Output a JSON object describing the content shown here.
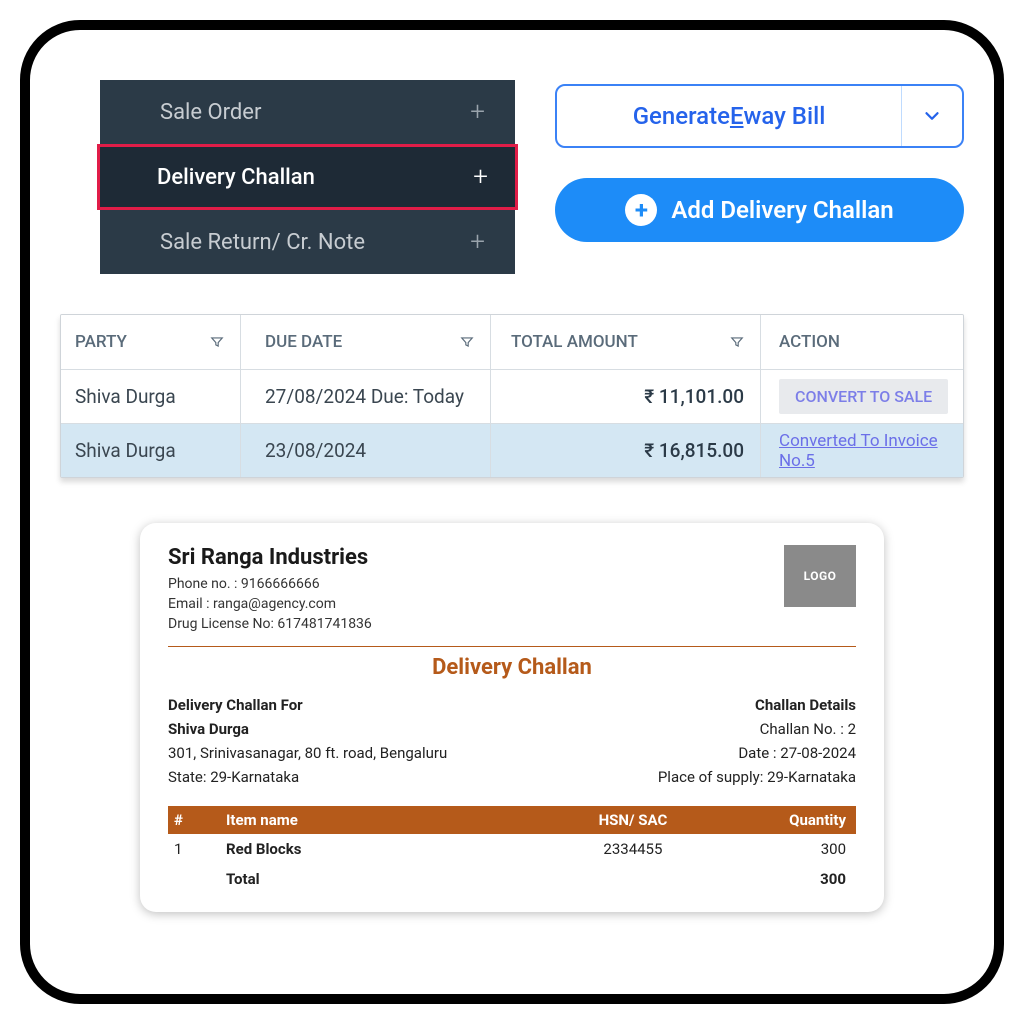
{
  "menu": {
    "items": [
      {
        "label": "Sale Order"
      },
      {
        "label": "Delivery Challan"
      },
      {
        "label": "Sale Return/ Cr. Note"
      }
    ]
  },
  "buttons": {
    "eway_prefix": "Generate ",
    "eway_underline": "E",
    "eway_suffix": "way Bill",
    "add_dc": "Add Delivery Challan"
  },
  "table": {
    "headers": {
      "party": "PARTY",
      "due": "DUE DATE",
      "amount": "TOTAL AMOUNT",
      "action": "ACTION"
    },
    "rows": [
      {
        "party": "Shiva Durga",
        "due": "27/08/2024 Due: Today",
        "amount": "₹ 11,101.00",
        "action_type": "button",
        "action_text": "CONVERT TO SALE"
      },
      {
        "party": "Shiva Durga",
        "due": "23/08/2024",
        "amount": "₹ 16,815.00",
        "action_type": "link",
        "action_text": "Converted To Invoice No.5"
      }
    ]
  },
  "doc": {
    "company": "Sri Ranga Industries",
    "phone_label": "Phone no. : ",
    "phone": "9166666666",
    "email_label": "Email : ",
    "email": "ranga@agency.com",
    "license_label": "Drug License No: ",
    "license": "617481741836",
    "logo": "LOGO",
    "title": "Delivery Challan",
    "left": {
      "heading": "Delivery Challan For",
      "name": "Shiva Durga",
      "address": "301, Srinivasanagar, 80 ft. road, Bengaluru",
      "state": "State: 29-Karnataka"
    },
    "right": {
      "heading": "Challan Details",
      "no": "Challan No. : 2",
      "date": "Date : 27-08-2024",
      "pos": "Place of supply: 29-Karnataka"
    },
    "items_header": {
      "num": "#",
      "name": "Item name",
      "hsn": "HSN/ SAC",
      "qty": "Quantity"
    },
    "items": [
      {
        "num": "1",
        "name": "Red Blocks",
        "hsn": "2334455",
        "qty": "300"
      }
    ],
    "total_label": "Total",
    "total_qty": "300"
  }
}
